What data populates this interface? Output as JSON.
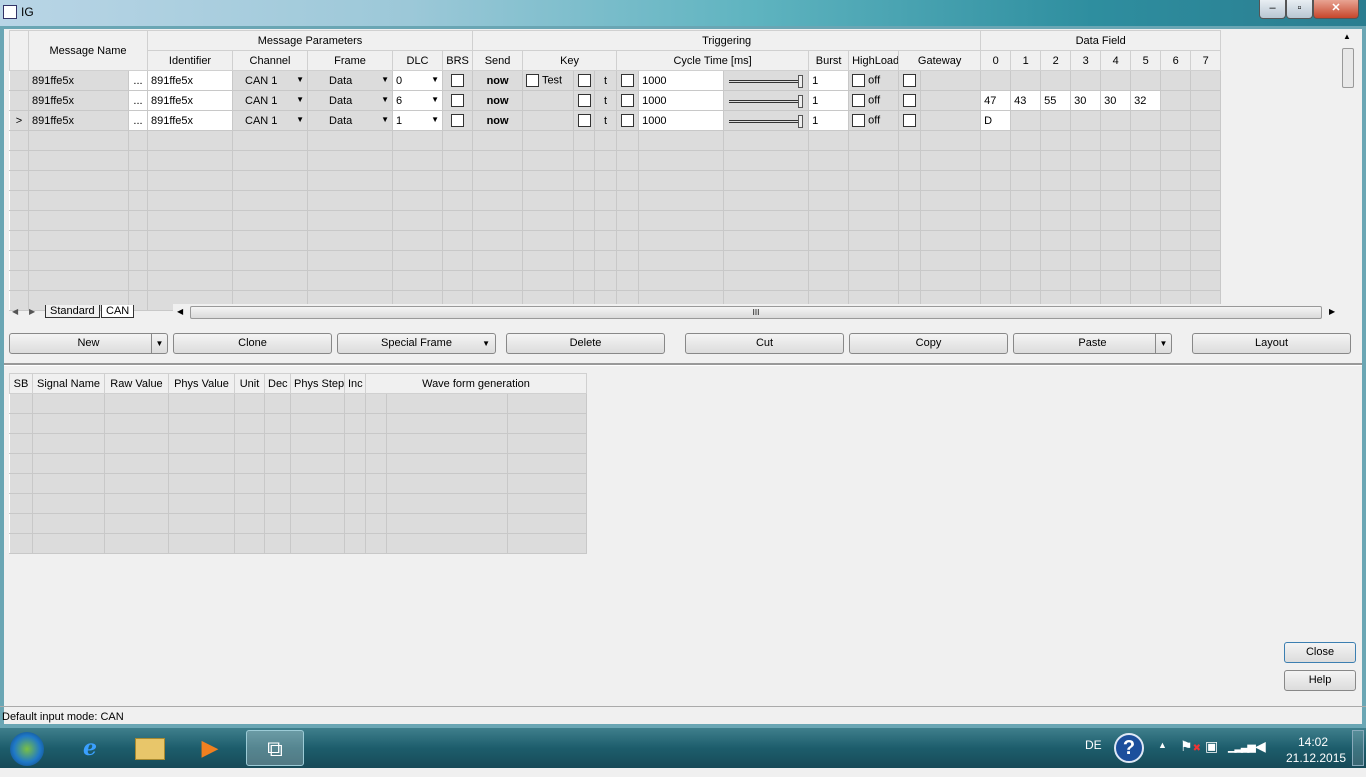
{
  "window": {
    "title": "IG",
    "min": "–",
    "max": "▫",
    "close": "✕"
  },
  "grid": {
    "group_headers": {
      "message_name": "Message Name",
      "message_parameters": "Message Parameters",
      "triggering": "Triggering",
      "data_field": "Data Field"
    },
    "columns": {
      "identifier": "Identifier",
      "channel": "Channel",
      "frame": "Frame",
      "dlc": "DLC",
      "brs": "BRS",
      "send": "Send",
      "key": "Key",
      "cycle_time": "Cycle Time [ms]",
      "burst": "Burst",
      "highload": "HighLoad",
      "gateway": "Gateway",
      "data": [
        "0",
        "1",
        "2",
        "3",
        "4",
        "5",
        "6",
        "7"
      ]
    },
    "rows": [
      {
        "marker": "",
        "name": "891ffe5x",
        "identifier": "891ffe5x",
        "channel": "CAN 1",
        "frame": "Data",
        "dlc": "0",
        "send": "now",
        "key_label": "Test",
        "key_t": "t",
        "cycle": "1000",
        "burst": "1",
        "highload": "off",
        "data": [
          "",
          "",
          "",
          "",
          "",
          "",
          "",
          ""
        ]
      },
      {
        "marker": "",
        "name": "891ffe5x",
        "identifier": "891ffe5x",
        "channel": "CAN 1",
        "frame": "Data",
        "dlc": "6",
        "send": "now",
        "key_label": "",
        "key_t": "t",
        "cycle": "1000",
        "burst": "1",
        "highload": "off",
        "data": [
          "47",
          "43",
          "55",
          "30",
          "30",
          "32",
          "",
          ""
        ]
      },
      {
        "marker": ">",
        "name": "891ffe5x",
        "identifier": "891ffe5x",
        "channel": "CAN 1",
        "frame": "Data",
        "dlc": "1",
        "send": "now",
        "key_label": "",
        "key_t": "t",
        "cycle": "1000",
        "burst": "1",
        "highload": "off",
        "data": [
          "D",
          "",
          "",
          "",
          "",
          "",
          "",
          ""
        ]
      }
    ],
    "ellipsis": "...",
    "tabs": [
      "Standard",
      "CAN"
    ],
    "hscroll_grip": "III"
  },
  "buttons": {
    "new": "New",
    "clone": "Clone",
    "special_frame": "Special Frame",
    "delete": "Delete",
    "cut": "Cut",
    "copy": "Copy",
    "paste": "Paste",
    "layout": "Layout",
    "close": "Close",
    "help": "Help"
  },
  "signals": {
    "columns": [
      "SB",
      "Signal Name",
      "Raw Value",
      "Phys Value",
      "Unit",
      "Dec",
      "Phys Step",
      "Inc",
      "Wave form generation"
    ]
  },
  "status": "Default input mode: CAN",
  "taskbar": {
    "lang": "DE",
    "time": "14:02",
    "date": "21.12.2015"
  }
}
